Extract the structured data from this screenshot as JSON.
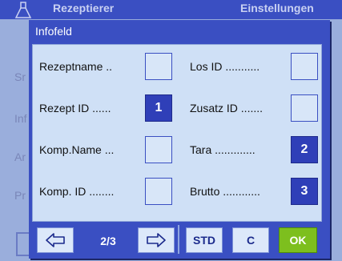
{
  "background": {
    "title": "Rezeptierer",
    "title_right": "Einstellungen",
    "rows": [
      "Sr",
      "Inf",
      "Ar",
      "Pr"
    ]
  },
  "dialog": {
    "title": "Infofeld",
    "fields_left": [
      {
        "label": "Rezeptname",
        "dots": "..",
        "value": ""
      },
      {
        "label": "Rezept ID",
        "dots": "......",
        "value": "1"
      },
      {
        "label": "Komp.Name",
        "dots": "...",
        "value": ""
      },
      {
        "label": "Komp. ID",
        "dots": "........",
        "value": ""
      }
    ],
    "fields_right": [
      {
        "label": "Los ID",
        "dots": "...........",
        "value": ""
      },
      {
        "label": "Zusatz ID",
        "dots": ".......",
        "value": ""
      },
      {
        "label": "Tara",
        "dots": ".............",
        "value": "2"
      },
      {
        "label": "Brutto",
        "dots": "............",
        "value": "3"
      }
    ]
  },
  "footer": {
    "page": "2/3",
    "std_label": "STD",
    "c_label": "C",
    "ok_label": "OK"
  },
  "colors": {
    "dialog_blue": "#3a4fc2",
    "panel": "#cfe0f6",
    "active_box": "#2f3fb8",
    "ok_green": "#7dbf1e"
  }
}
